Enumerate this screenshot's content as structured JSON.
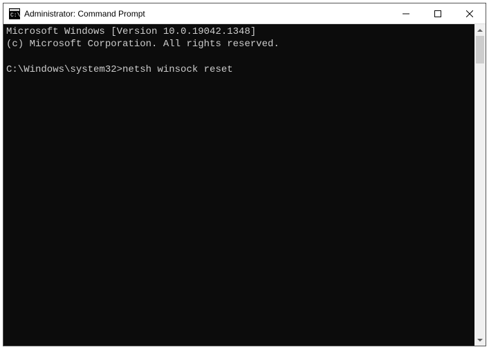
{
  "window": {
    "title": "Administrator: Command Prompt"
  },
  "terminal": {
    "line1": "Microsoft Windows [Version 10.0.19042.1348]",
    "line2": "(c) Microsoft Corporation. All rights reserved.",
    "prompt": "C:\\Windows\\system32>",
    "command": "netsh winsock reset"
  }
}
